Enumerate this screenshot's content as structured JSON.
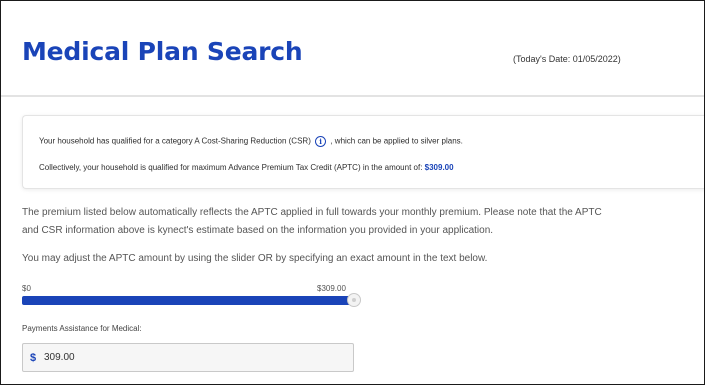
{
  "header": {
    "title": "Medical Plan Search",
    "todays_date": "(Today's Date: 01/05/2022)"
  },
  "info_card": {
    "csr_prefix": "Your household has qualified for a category A Cost-Sharing Reduction (CSR)",
    "csr_suffix": ", which can be applied to silver plans.",
    "info_icon_glyph": "i",
    "aptc_prefix": "Collectively, your household is qualified for maximum Advance Premium Tax Credit (APTC) in the amount of:",
    "aptc_amount": "$309.00"
  },
  "body": {
    "para1_line1": "The premium listed below automatically reflects the APTC applied in full towards your monthly premium. Please note that the APTC",
    "para1_line2": "and CSR information above is kynect's estimate based on the information you provided in your application.",
    "para2": "You may adjust the APTC amount by using the slider OR by specifying an exact amount in the text below."
  },
  "slider": {
    "min_label": "$0",
    "max_label": "$309.00",
    "value_fraction": 1.0
  },
  "assistance_field": {
    "label": "Payments Assistance for Medical:",
    "currency": "$",
    "value": "309.00"
  },
  "colors": {
    "brand_blue": "#1a44b8",
    "text_gray": "#555555"
  },
  "icons": {
    "info": "info-circle-icon"
  }
}
